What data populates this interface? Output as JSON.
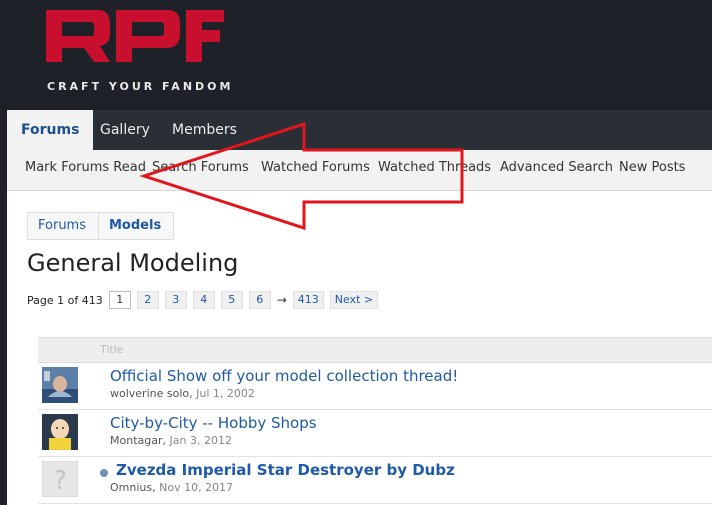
{
  "header": {
    "tagline": "CRAFT YOUR FANDOM",
    "accent": "#c8102e"
  },
  "nav": {
    "tabs": [
      "Forums",
      "Gallery",
      "Members"
    ],
    "active": "Forums"
  },
  "subnav": [
    "Mark Forums Read",
    "Search Forums",
    "Watched Forums",
    "Watched Threads",
    "Advanced Search",
    "New Posts"
  ],
  "breadcrumb": [
    "Forums",
    "Models"
  ],
  "page_title": "General Modeling",
  "pagination": {
    "label": "Page 1 of 413",
    "pages": [
      "1",
      "2",
      "3",
      "4",
      "5",
      "6"
    ],
    "arrow": "→",
    "last": "413",
    "next": "Next >"
  },
  "table": {
    "header_title": "Title",
    "threads": [
      {
        "title": "Official Show off your model collection thread!",
        "author": "wolverine solo",
        "date": "Jul 1, 2002"
      },
      {
        "title": "City-by-City -- Hobby Shops",
        "author": "Montagar",
        "date": "Jan 3, 2012"
      },
      {
        "title": "Zvezda Imperial Star Destroyer by Dubz",
        "author": "Omnius",
        "date": "Nov 10, 2017"
      }
    ]
  }
}
